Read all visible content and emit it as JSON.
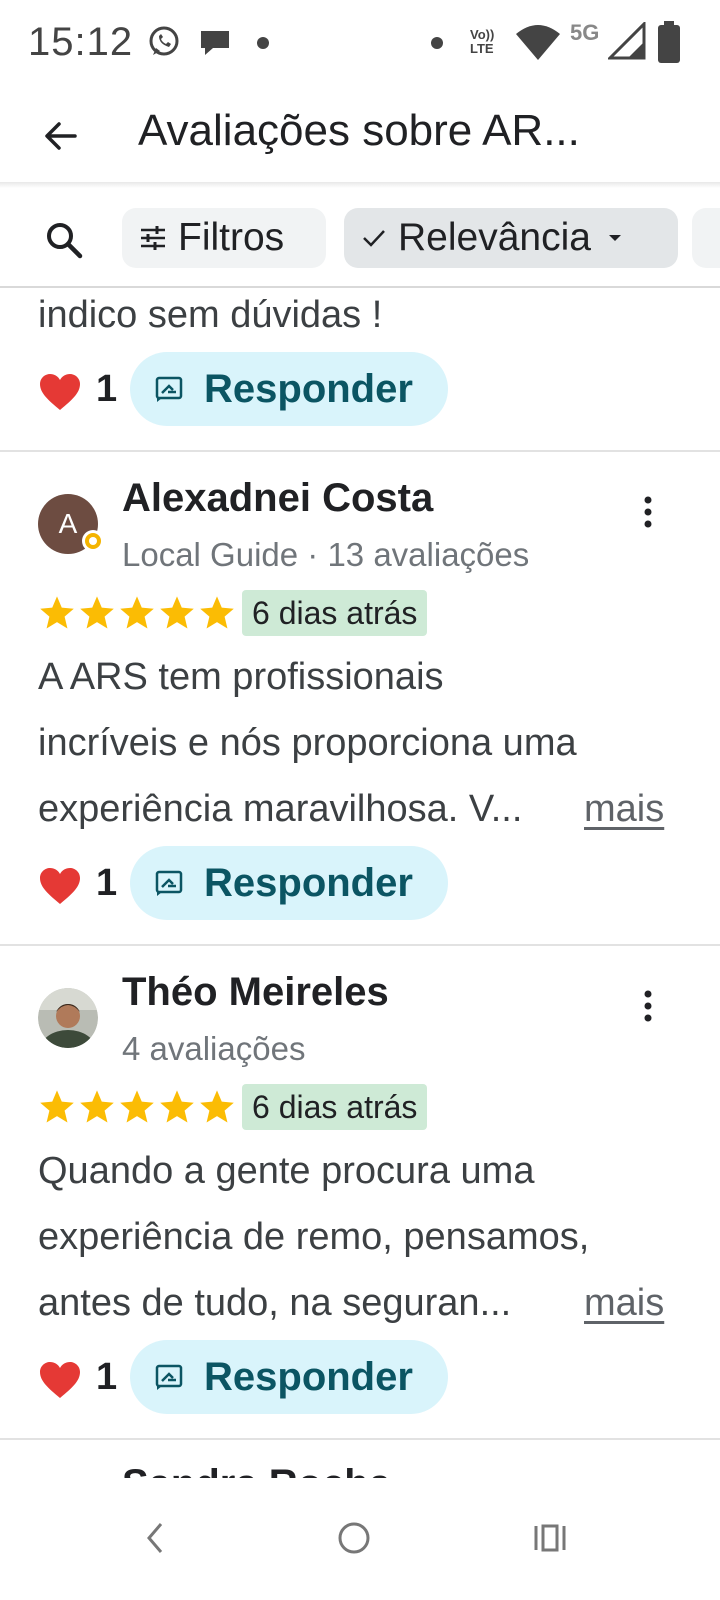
{
  "status_bar": {
    "time": "15:12",
    "network_volte": "Vo)) LTE",
    "network_5g": "5G",
    "icons": [
      "whatsapp-icon",
      "chat-icon",
      "dot-icon",
      "dot-icon",
      "volte-icon",
      "wifi-icon",
      "signal-icon",
      "battery-icon"
    ]
  },
  "app_bar": {
    "title": "Avaliações sobre AR..."
  },
  "filters": {
    "filters_label": "Filtros",
    "sort_label": "Relevância"
  },
  "reviews": [
    {
      "text_lines": [
        "indico sem dúvidas !"
      ],
      "like_count": "1",
      "reply_label": "Responder"
    },
    {
      "author": "Alexadnei Costa",
      "avatar_letter": "A",
      "meta": "Local Guide · 13 avaliações",
      "rating": 5,
      "date": "6 dias atrás",
      "text_lines": [
        "A ARS tem profissionais",
        "incríveis e nós proporciona uma",
        "experiência maravilhosa. V..."
      ],
      "more_label": "mais",
      "like_count": "1",
      "reply_label": "Responder"
    },
    {
      "author": "Théo Meireles",
      "meta": "4 avaliações",
      "rating": 5,
      "date": "6 dias atrás",
      "text_lines": [
        "Quando a gente procura uma",
        "experiência de remo, pensamos,",
        "antes de tudo, na seguran..."
      ],
      "more_label": "mais",
      "like_count": "1",
      "reply_label": "Responder"
    }
  ],
  "next_review_author": "Sandra Rocha",
  "colors": {
    "reply_bg": "#d9f4fb",
    "reply_text": "#0b5563",
    "date_badge_bg": "#ceead6",
    "star": "#fbbc04",
    "heart": "#e53935"
  },
  "nav_bar": [
    "back-nav-icon",
    "home-nav-icon",
    "recents-nav-icon"
  ]
}
